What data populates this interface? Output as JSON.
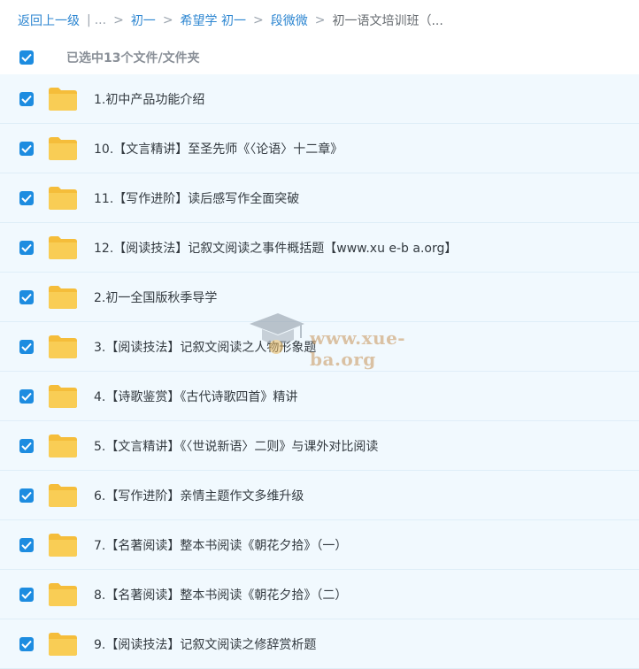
{
  "breadcrumb": {
    "back": "返回上一级",
    "ellipsis": "...",
    "items": [
      "初一",
      "希望学 初一",
      "段微微"
    ],
    "current": "初一语文培训班（..."
  },
  "selection": {
    "text": "已选中13个文件/文件夹"
  },
  "files": [
    "1.初中产品功能介绍",
    "10.【文言精讲】至圣先师《〈论语〉十二章》",
    "11.【写作进阶】读后感写作全面突破",
    "12.【阅读技法】记叙文阅读之事件概括题【www.xu e-b a.org】",
    "2.初一全国版秋季导学",
    "3.【阅读技法】记叙文阅读之人物形象题",
    "4.【诗歌鉴赏】《古代诗歌四首》精讲",
    "5.【文言精讲】《〈世说新语〉二则》与课外对比阅读",
    "6.【写作进阶】亲情主题作文多维升级",
    "7.【名著阅读】整本书阅读《朝花夕拾》（一）",
    "8.【名著阅读】整本书阅读《朝花夕拾》（二）",
    "9.【阅读技法】记叙文阅读之修辞赏析题"
  ],
  "watermark": {
    "text": "www.xue-ba.org"
  },
  "colors": {
    "accent": "#1d8ce0",
    "link": "#2d86d1",
    "folder": "#f7c64a",
    "row_bg": "#f1f9fe"
  },
  "icons": {
    "checkbox": "checkbox-checked-icon",
    "folder": "folder-icon"
  }
}
